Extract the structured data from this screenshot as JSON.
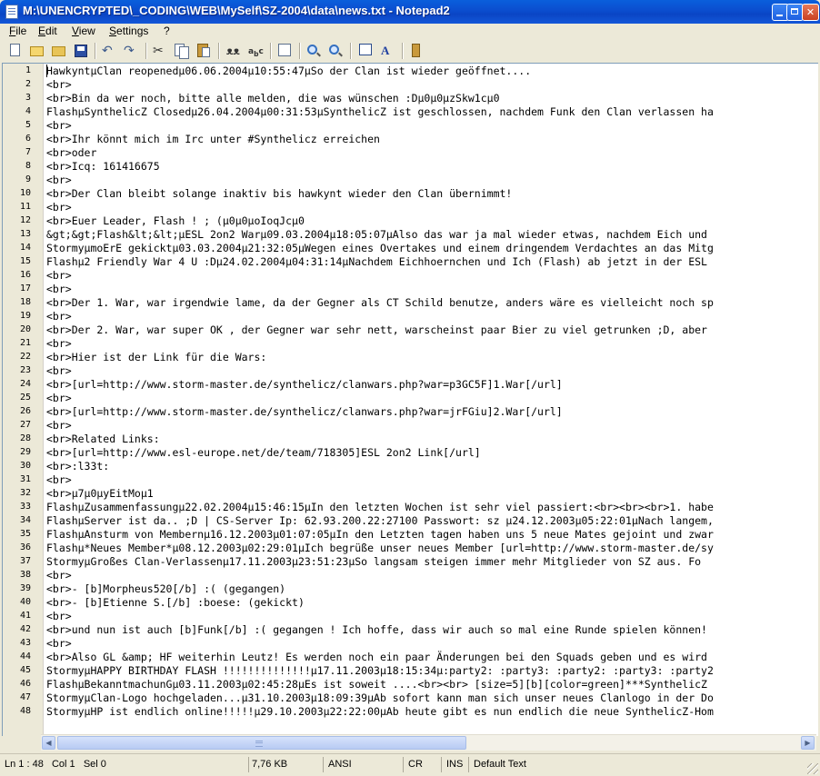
{
  "window": {
    "title": "M:\\UNENCRYPTED\\_CODING\\WEB\\MySelf\\SZ-2004\\data\\news.txt - Notepad2"
  },
  "menu": [
    "File",
    "Edit",
    "View",
    "Settings",
    "?"
  ],
  "toolbar_icons": [
    "new-icon",
    "open-icon",
    "browse-icon",
    "save-icon",
    "undo-icon",
    "redo-icon",
    "cut-icon",
    "copy-icon",
    "paste-icon",
    "find-icon",
    "replace-icon",
    "word-wrap-icon",
    "zoom-in-icon",
    "zoom-out-icon",
    "scheme-icon",
    "font-icon",
    "exit-icon"
  ],
  "editor": {
    "lines": [
      "HawkyntμClan reopenedμ06.06.2004μ10:55:47μSo der Clan ist wieder geöffnet....",
      "<br>",
      "<br>Bin da wer noch, bitte alle melden, die was wünschen :Dμ0μ0μzSkw1cμ0",
      "FlashμSynthelicZ Closedμ26.04.2004μ00:31:53μSynthelicZ ist geschlossen, nachdem Funk den Clan verlassen ha",
      "<br>",
      "<br>Ihr könnt mich im Irc unter #Synthelicz erreichen",
      "<br>oder",
      "<br>Icq: 161416675",
      "<br>",
      "<br>Der Clan bleibt solange inaktiv bis hawkynt wieder den Clan übernimmt!",
      "<br>",
      "<br>Euer Leader, Flash ! ; (μ0μ0μoIoqJcμ0",
      "&gt;&gt;Flash&lt;&lt;μESL 2on2 Warμ09.03.2004μ18:05:07μAlso das war ja mal wieder etwas, nachdem Eich und",
      "StormyμmoErE gekicktμ03.03.2004μ21:32:05μWegen eines Overtakes und einem dringendem Verdachtes an das Mitg",
      "Flashμ2 Friendly War 4 U :Dμ24.02.2004μ04:31:14μNachdem Eichhoernchen und Ich (Flash) ab jetzt in der ESL",
      "<br>",
      "<br>",
      "<br>Der 1. War, war irgendwie lame, da der Gegner als CT Schild benutze, anders wäre es vielleicht noch sp",
      "<br>",
      "<br>Der 2. War, war super OK , der Gegner war sehr nett, warscheinst paar Bier zu viel getrunken ;D, aber",
      "<br>",
      "<br>Hier ist der Link für die Wars:",
      "<br>",
      "<br>[url=http://www.storm-master.de/synthelicz/clanwars.php?war=p3GC5F]1.War[/url]",
      "<br>",
      "<br>[url=http://www.storm-master.de/synthelicz/clanwars.php?war=jrFGiu]2.War[/url]",
      "<br>",
      "<br>Related Links:",
      "<br>[url=http://www.esl-europe.net/de/team/718305]ESL 2on2 Link[/url]",
      "<br>:l33t:",
      "<br>",
      "<br>μ7μ0μyEitMoμ1",
      "FlashμZusammenfassungμ22.02.2004μ15:46:15μIn den letzten Wochen ist sehr viel passiert:<br><br><br>1. habe",
      "FlashμServer ist da.. ;D | CS-Server Ip: 62.93.200.22:27100 Passwort: sz μ24.12.2003μ05:22:01μNach langem,",
      "FlashμAnsturm von Membernμ16.12.2003μ01:07:05μIn den Letzten tagen haben uns 5 neue Mates gejoint und zwar",
      "Flashμ*Neues Member*μ08.12.2003μ02:29:01μIch begrüße unser neues Member [url=http://www.storm-master.de/sy",
      "StormyμGroßes Clan-Verlassenμ17.11.2003μ23:51:23μSo langsam steigen immer mehr Mitglieder von SZ aus. Fo",
      "<br>",
      "<br>- [b]Morpheus520[/b] :( (gegangen)",
      "<br>- [b]Etienne S.[/b] :boese: (gekickt)",
      "<br>",
      "<br>und nun ist auch [b]Funk[/b] :( gegangen ! Ich hoffe, dass wir auch so mal eine Runde spielen können!",
      "<br>",
      "<br>Also GL &amp; HF weiterhin Leutz! Es werden noch ein paar Änderungen bei den Squads geben und es wird",
      "StormyμHAPPY BIRTHDAY FLASH !!!!!!!!!!!!!!μ17.11.2003μ18:15:34μ:party2: :party3: :party2: :party3: :party2",
      "FlashμBekanntmachunGμ03.11.2003μ02:45:28μEs ist soweit ....<br><br> [size=5][b][color=green]***SynthelicZ",
      "StormyμClan-Logo hochgeladen...μ31.10.2003μ18:09:39μAb sofort kann man sich unser neues Clanlogo in der Do",
      "StormyμHP ist endlich online!!!!!μ29.10.2003μ22:22:00μAb heute gibt es nun endlich die neue SynthelicZ-Hom"
    ]
  },
  "status": {
    "position": "Ln 1 : 48   Col 1   Sel 0",
    "size": "7,76 KB",
    "encoding": "ANSI",
    "line_ending": "CR",
    "insert_mode": "INS",
    "scheme": "Default Text"
  }
}
